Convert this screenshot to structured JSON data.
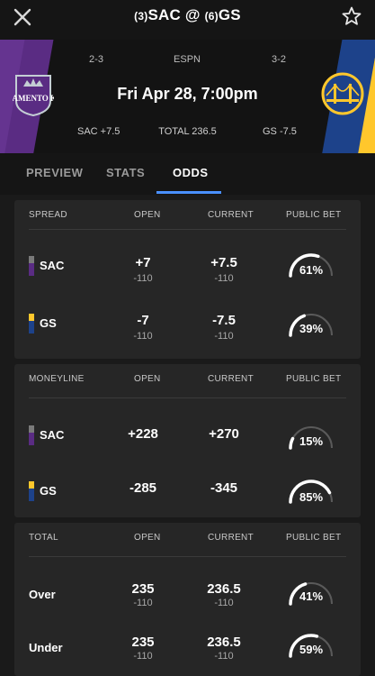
{
  "nav": {
    "away_seed": "(3)",
    "away_abbr": "SAC",
    "at": "@",
    "home_seed": "(6)",
    "home_abbr": "GS"
  },
  "header": {
    "away_record": "2-3",
    "network": "ESPN",
    "home_record": "3-2",
    "datetime": "Fri Apr 28, 7:00pm",
    "away_line": "SAC +7.5",
    "total_line": "TOTAL 236.5",
    "home_line": "GS -7.5",
    "away_logo_text": "SACRAMENTO KINGS"
  },
  "tabs": [
    {
      "label": "PREVIEW",
      "active": false
    },
    {
      "label": "STATS",
      "active": false
    },
    {
      "label": "ODDS",
      "active": true
    }
  ],
  "colors": {
    "sac_top": "#7a7a7a",
    "sac_bottom": "#5a2c83",
    "gs_top": "#ffc72c",
    "gs_bottom": "#1d428a",
    "accent": "#4a90ff"
  },
  "spread": {
    "title": "SPREAD",
    "col_open": "OPEN",
    "col_current": "CURRENT",
    "col_public": "PUBLIC BET",
    "rows": [
      {
        "team": "SAC",
        "open": "+7",
        "open_juice": "-110",
        "current": "+7.5",
        "current_juice": "-110",
        "public": "61%",
        "public_pct": 61
      },
      {
        "team": "GS",
        "open": "-7",
        "open_juice": "-110",
        "current": "-7.5",
        "current_juice": "-110",
        "public": "39%",
        "public_pct": 39
      }
    ]
  },
  "moneyline": {
    "title": "MONEYLINE",
    "col_open": "OPEN",
    "col_current": "CURRENT",
    "col_public": "PUBLIC BET",
    "rows": [
      {
        "team": "SAC",
        "open": "+228",
        "current": "+270",
        "public": "15%",
        "public_pct": 15
      },
      {
        "team": "GS",
        "open": "-285",
        "current": "-345",
        "public": "85%",
        "public_pct": 85
      }
    ]
  },
  "total": {
    "title": "TOTAL",
    "col_open": "OPEN",
    "col_current": "CURRENT",
    "col_public": "PUBLIC BET",
    "rows": [
      {
        "label": "Over",
        "open": "235",
        "open_juice": "-110",
        "current": "236.5",
        "current_juice": "-110",
        "public": "41%",
        "public_pct": 41
      },
      {
        "label": "Under",
        "open": "235",
        "open_juice": "-110",
        "current": "236.5",
        "current_juice": "-110",
        "public": "59%",
        "public_pct": 59
      }
    ]
  }
}
